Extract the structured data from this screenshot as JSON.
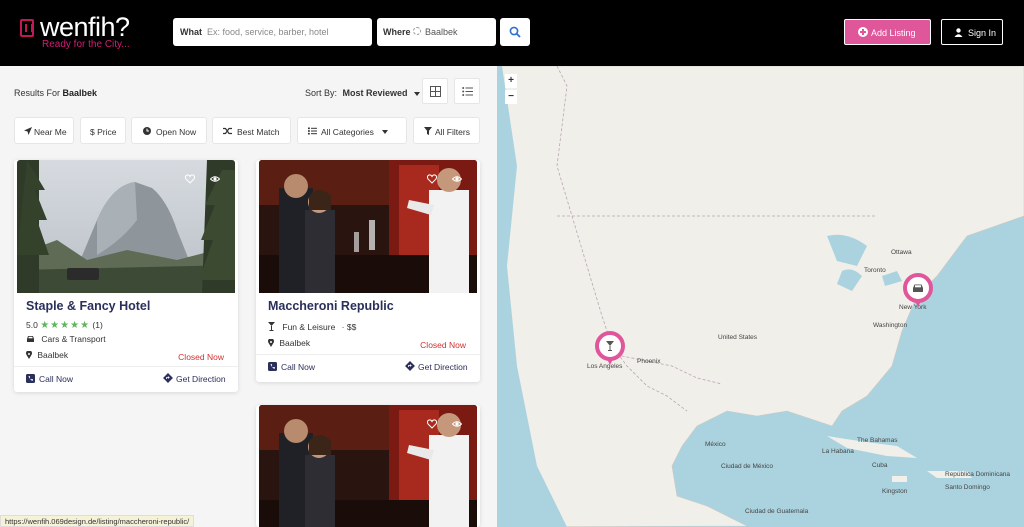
{
  "header": {
    "logo_text": "wenfih?",
    "logo_tagline": "Ready for the City...",
    "search_what_label": "What",
    "search_what_placeholder": "Ex: food, service, barber, hotel",
    "search_where_label": "Where",
    "search_where_value": "Baalbek",
    "add_listing_label": "Add Listing",
    "sign_in_label": "Sign In"
  },
  "results": {
    "prefix": "Results For",
    "location": "Baalbek",
    "sort_label": "Sort By:",
    "sort_value": "Most Reviewed"
  },
  "filters": [
    {
      "label": "Near Me"
    },
    {
      "label": "$ Price"
    },
    {
      "label": "Open Now"
    },
    {
      "label": "Best Match"
    },
    {
      "label": "All Categories"
    },
    {
      "label": "All Filters"
    }
  ],
  "listings": [
    {
      "title": "Staple & Fancy Hotel",
      "rating": "5.0",
      "stars": "★★★★★",
      "reviews": "(1)",
      "category": "Cars & Transport",
      "location": "Baalbek",
      "status": "Closed Now",
      "call": "Call Now",
      "direction": "Get Direction"
    },
    {
      "title": "Maccheroni Republic",
      "category": "Fun & Leisure",
      "price": "$$",
      "location": "Baalbek",
      "status": "Closed Now",
      "call": "Call Now",
      "direction": "Get Direction"
    }
  ],
  "map": {
    "zoom_in": "+",
    "zoom_out": "−",
    "labels": {
      "ottawa": "Ottawa",
      "toronto": "Toronto",
      "new_york": "New York",
      "washington": "Washington",
      "united_states": "United States",
      "phoenix": "Phoenix",
      "los_angeles": "Los Angeles",
      "mexico": "México",
      "mexico_city": "Ciudad de México",
      "havana": "La Habana",
      "bahamas": "The Bahamas",
      "cuba": "Cuba",
      "kingston": "Kingston",
      "dominican": "República Dominicana",
      "santo_domingo": "Santo Domingo",
      "guatemala": "Ciudad de Guatemala"
    }
  },
  "status_bar_url": "https://wenfih.069design.de/listing/maccheroni-republic/",
  "colors": {
    "brand_pink": "#e0569a",
    "closed_red": "#d32f2f",
    "star_green": "#5db65a",
    "title_navy": "#2a2f5b"
  }
}
